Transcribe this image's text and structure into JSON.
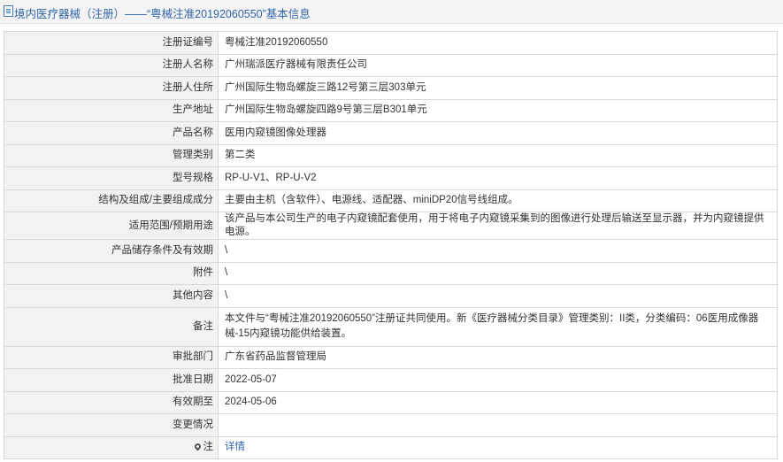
{
  "header": {
    "title": "境内医疗器械（注册）——“粤械注准20192060550”基本信息",
    "icon": "document-icon"
  },
  "rows": [
    {
      "label": "注册证编号",
      "value": "粤械注准20192060550"
    },
    {
      "label": "注册人名称",
      "value": "广州瑞派医疗器械有限责任公司"
    },
    {
      "label": "注册人住所",
      "value": "广州国际生物岛螺旋三路12号第三层303单元"
    },
    {
      "label": "生产地址",
      "value": "广州国际生物岛螺旋四路9号第三层B301单元"
    },
    {
      "label": "产品名称",
      "value": "医用内窥镜图像处理器"
    },
    {
      "label": "管理类别",
      "value": "第二类"
    },
    {
      "label": "型号规格",
      "value": "RP-U-V1、RP-U-V2"
    },
    {
      "label": "结构及组成/主要组成成分",
      "value": "主要由主机（含软件）、电源线、适配器、miniDP20信号线组成。"
    },
    {
      "label": "适用范围/预期用途",
      "value": "该产品与本公司生产的电子内窥镜配套使用，用于将电子内窥镜采集到的图像进行处理后输送至显示器，并为内窥镜提供电源。"
    },
    {
      "label": "产品储存条件及有效期",
      "value": "\\"
    },
    {
      "label": "附件",
      "value": "\\"
    },
    {
      "label": "其他内容",
      "value": "\\"
    },
    {
      "label": "备注",
      "value": "本文件与“粤械注准20192060550”注册证共同使用。新《医疗器械分类目录》管理类别：II类，分类编码：06医用成像器械-15内窥镜功能供给装置。"
    },
    {
      "label": "审批部门",
      "value": "广东省药品监督管理局"
    },
    {
      "label": "批准日期",
      "value": "2022-05-07"
    },
    {
      "label": "有效期至",
      "value": "2024-05-06"
    },
    {
      "label": "变更情况",
      "value": ""
    }
  ],
  "note_row": {
    "label": "注",
    "icon": "pin-icon",
    "link": "详情"
  }
}
